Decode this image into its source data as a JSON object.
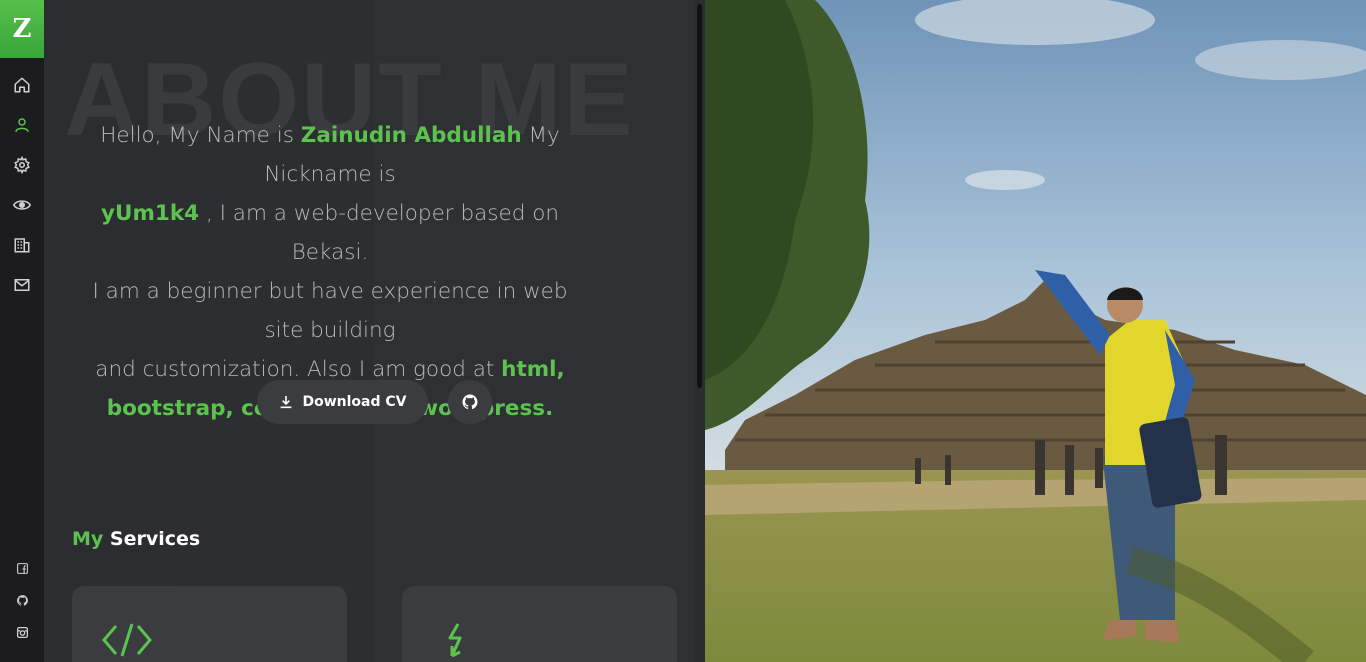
{
  "brand": {
    "logo_letter": "Z"
  },
  "sidebar": {
    "nav": [
      {
        "name": "home-icon",
        "active": false
      },
      {
        "name": "user-icon",
        "active": true
      },
      {
        "name": "gear-icon",
        "active": false
      },
      {
        "name": "eye-icon",
        "active": false
      },
      {
        "name": "building-icon",
        "active": false
      },
      {
        "name": "mail-icon",
        "active": false
      }
    ],
    "social": [
      "facebook-icon",
      "github-icon",
      "instagram-icon"
    ]
  },
  "about": {
    "bg_title": "ABOUT ME",
    "p1": "Hello, My Name is ",
    "name": "Zainudin Abdullah",
    "p2": " My Nickname is ",
    "nickname": "yUm1k4",
    "p3": " , I am a web-developer based on Bekasi.",
    "p4": "I am a beginner but have experience in web site building",
    "p5": "and customization. Also I am good at ",
    "skills": "html, bootstrap, codeigniter, & wordpress."
  },
  "actions": {
    "download_cv": "Download CV"
  },
  "services": {
    "title_accent": "My",
    "title_rest": " Services"
  },
  "colors": {
    "accent": "#5cc34f",
    "sidebar_bg": "#1c1c1e",
    "content_bg": "#2d2e32",
    "card_bg": "#3b3c40"
  },
  "photo": {
    "alt": ""
  }
}
